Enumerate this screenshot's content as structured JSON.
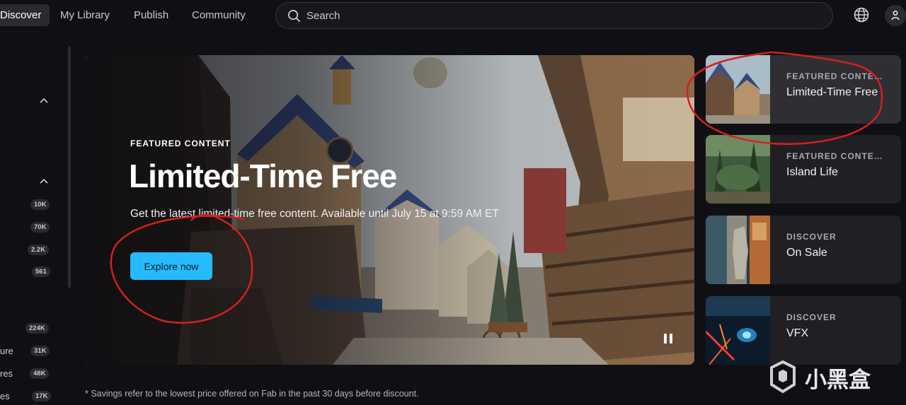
{
  "nav": {
    "tabs": [
      {
        "label": "Discover",
        "active": true
      },
      {
        "label": "My Library",
        "active": false
      },
      {
        "label": "Publish",
        "active": false
      },
      {
        "label": "Community",
        "active": false
      }
    ],
    "search_placeholder": "Search",
    "icons": {
      "search": "search-icon",
      "language": "globe-icon",
      "account": "user-icon"
    }
  },
  "sidebar": {
    "counts": [
      "10K",
      "70K",
      "2.2K",
      "561",
      "224K",
      "31K",
      "48K",
      "17K"
    ],
    "partial_labels": [
      "ure",
      "res",
      "es"
    ]
  },
  "hero": {
    "eyebrow": "FEATURED CONTENT",
    "title": "Limited-Time Free",
    "subtitle": "Get the latest limited-time free content. Available until July 15 at 9:59 AM ET",
    "cta": "Explore now"
  },
  "features": [
    {
      "eyebrow": "FEATURED CONTENT",
      "title": "Limited-Time Free",
      "active": true
    },
    {
      "eyebrow": "FEATURED CONTENT",
      "title": "Island Life",
      "active": false
    },
    {
      "eyebrow": "DISCOVER",
      "title": "On Sale",
      "active": false
    },
    {
      "eyebrow": "DISCOVER",
      "title": "VFX",
      "active": false
    }
  ],
  "footnote": "* Savings refer to the lowest price offered on Fab in the past 30 days before discount.",
  "watermark": "小黑盒",
  "colors": {
    "accent": "#26bbff",
    "background": "#101014",
    "annotation": "#d42020"
  }
}
